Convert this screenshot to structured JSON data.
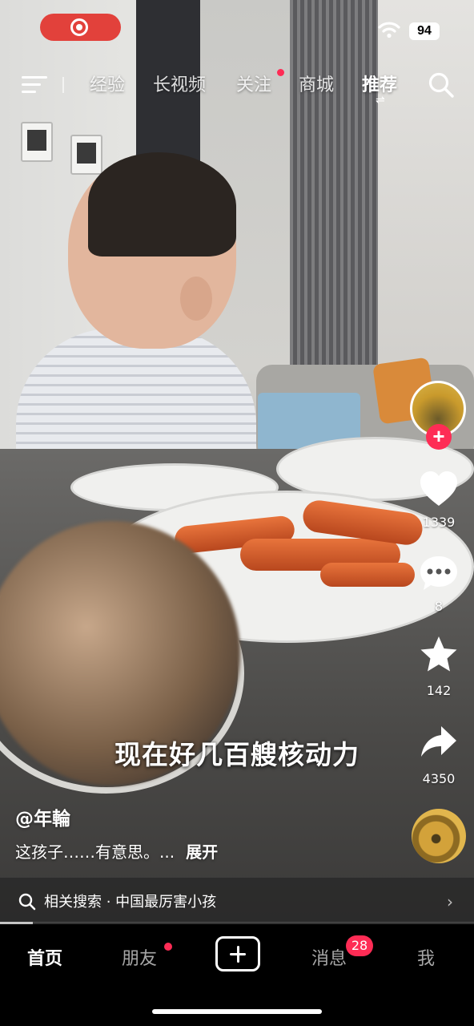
{
  "status_bar": {
    "recording_icon": "screen-record-icon",
    "wifi_icon": "wifi-icon",
    "battery_level": "94"
  },
  "top_nav": {
    "menu_icon": "menu-icon",
    "tabs": [
      {
        "label": "经验",
        "active": false
      },
      {
        "label": "长视频",
        "active": false
      },
      {
        "label": "关注",
        "active": false,
        "has_dot": true
      },
      {
        "label": "商城",
        "active": false
      },
      {
        "label": "推荐",
        "active": true
      }
    ],
    "search_icon": "search-icon"
  },
  "right_rail": {
    "like_count": "1339",
    "comment_count": "8",
    "favorite_count": "142",
    "share_count": "4350"
  },
  "video": {
    "subtitle": "现在好几百艘核动力",
    "author": "@年輪",
    "description": "这孩子……有意思。...",
    "expand_label": "展开"
  },
  "related_search": {
    "label": "相关搜索 · 中国最厉害小孩"
  },
  "progress": 0.07,
  "bottom_nav": {
    "home": "首页",
    "friends": "朋友",
    "messages": "消息",
    "messages_badge": "28",
    "me": "我"
  },
  "colors": {
    "accent": "#fe2c55",
    "record_pill": "#e2413b"
  }
}
